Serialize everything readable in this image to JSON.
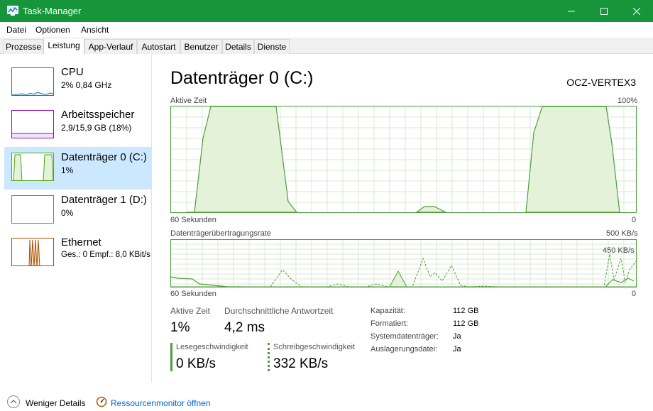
{
  "window": {
    "title": "Task-Manager"
  },
  "menu": [
    "Datei",
    "Optionen",
    "Ansicht"
  ],
  "tabs": [
    "Prozesse",
    "Leistung",
    "App-Verlauf",
    "Autostart",
    "Benutzer",
    "Details",
    "Dienste"
  ],
  "active_tab": "Leistung",
  "resources": [
    {
      "name": "CPU",
      "value": "2% 0,84 GHz",
      "color": "#117dbb"
    },
    {
      "name": "Arbeitsspeicher",
      "value": "2,9/15,9 GB (18%)",
      "color": "#8b12ae"
    },
    {
      "name": "Datenträger 0 (C:)",
      "value": "1%",
      "color": "#4da60c"
    },
    {
      "name": "Datenträger 1 (D:)",
      "value": "0%",
      "color": "#4da60c"
    },
    {
      "name": "Ethernet",
      "value": "Ges.: 0 Empf.: 8,0 KBit/s",
      "color": "#a74f01"
    }
  ],
  "main": {
    "title": "Datenträger 0 (C:)",
    "model": "OCZ-VERTEX3",
    "graph1": {
      "label": "Aktive Zeit",
      "max": "100%",
      "xlabel_left": "60 Sekunden",
      "xlabel_right": "0"
    },
    "graph2": {
      "label": "Datenträgerübertragungsrate",
      "max": "500 KB/s",
      "inner": "450 KB/s",
      "xlabel_left": "60 Sekunden",
      "xlabel_right": "0"
    }
  },
  "stats": {
    "active_time": {
      "label": "Aktive Zeit",
      "value": "1%"
    },
    "avg_response": {
      "label": "Durchschnittliche Antwortzeit",
      "value": "4,2 ms"
    },
    "read_speed": {
      "label": "Lesegeschwindigkeit",
      "value": "0 KB/s"
    },
    "write_speed": {
      "label": "Schreibgeschwindigkeit",
      "value": "332 KB/s"
    }
  },
  "details": [
    {
      "key": "Kapazität:",
      "value": "112 GB"
    },
    {
      "key": "Formatiert:",
      "value": "112 GB"
    },
    {
      "key": "Systemdatenträger:",
      "value": "Ja"
    },
    {
      "key": "Auslagerungsdatei:",
      "value": "Ja"
    }
  ],
  "footer": {
    "fewer_details": "Weniger Details",
    "resource_monitor": "Ressourcenmonitor öffnen"
  },
  "colors": {
    "titlebar": "#16953b",
    "accent_green": "#4c9f38",
    "link": "#0066cc",
    "selection": "#cce8ff"
  }
}
